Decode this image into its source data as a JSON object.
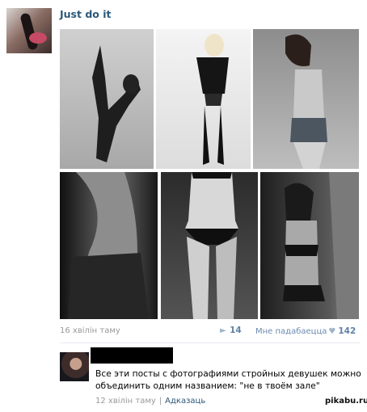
{
  "post": {
    "title": "Just do it",
    "time": "16 хвілін таму",
    "share_count": "14",
    "like_label": "Мне падабаецца",
    "like_count": "142"
  },
  "comment": {
    "text": "Все эти посты с фотографиями стройных девушек можно объединить одним названием: \"не в твоём зале\"",
    "time": "12 хвілін таму",
    "reply_label": "Адказаць"
  },
  "watermark": "pikabu.ru",
  "icons": {
    "share": "megaphone-icon",
    "like": "heart-icon"
  },
  "colors": {
    "link": "#2b587a",
    "meta": "#999999",
    "accent": "#5e81a8"
  }
}
